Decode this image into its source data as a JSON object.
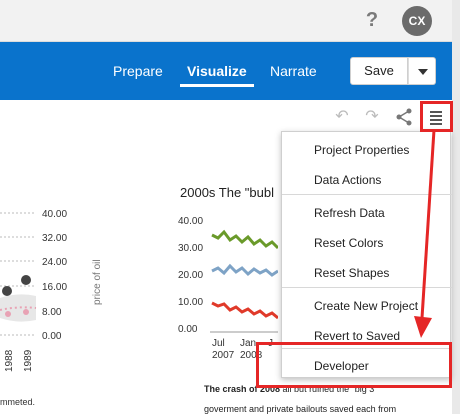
{
  "header": {
    "help_label": "?",
    "avatar_initials": "CX"
  },
  "nav": {
    "prepare": "Prepare",
    "visualize": "Visualize",
    "narrate": "Narrate"
  },
  "toolbar": {
    "save_label": "Save"
  },
  "menu": {
    "items": [
      "Project Properties",
      "Data Actions",
      "Refresh Data",
      "Reset Colors",
      "Reset Shapes",
      "Create New Project",
      "Revert to Saved",
      "Developer"
    ]
  },
  "left_chart": {
    "y_ticks": [
      "40.00",
      "32.00",
      "24.00",
      "16.00",
      "8.00",
      "0.00"
    ],
    "y_label": "price of oil",
    "x_ticks": [
      "1988",
      "1989"
    ],
    "caption": "mmeted."
  },
  "right_chart": {
    "title": "2000s The \"bubl",
    "y_ticks": [
      "40.00",
      "30.00",
      "20.00",
      "10.00",
      "0.00"
    ],
    "x_ticks": [
      [
        "Jul",
        "2007"
      ],
      [
        "Jan",
        "2008"
      ],
      [
        "J",
        ""
      ]
    ],
    "caption_bold": "The crash of 2008",
    "caption_rest": " all but ruined the \"big 3\"",
    "caption_line2": "goverment and private bailouts saved each from"
  },
  "colors": {
    "brand": "#0a73cc",
    "highlight": "#e52626",
    "series_green": "#6a9a2a",
    "series_blue": "#7ea3c6",
    "series_red": "#e03a2a"
  },
  "icons": {
    "undo": "undo-icon",
    "redo": "redo-icon",
    "share": "share-icon",
    "menu": "hamburger-menu-icon"
  }
}
